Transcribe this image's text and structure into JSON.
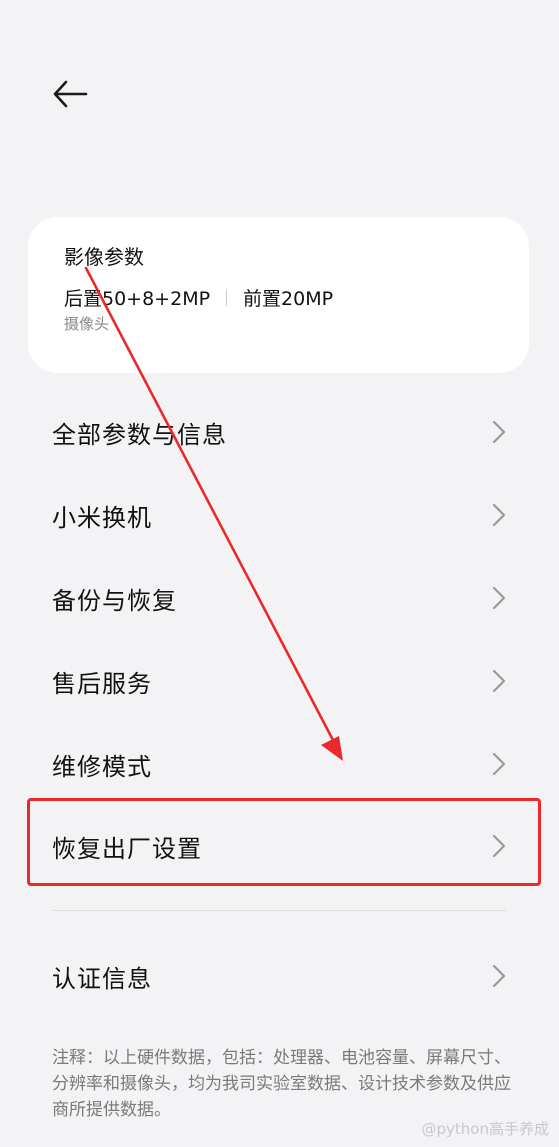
{
  "card": {
    "title": "影像参数",
    "rear": "后置50+8+2MP",
    "front": "前置20MP",
    "subtitle": "摄像头"
  },
  "menu": {
    "items": [
      {
        "label": "全部参数与信息"
      },
      {
        "label": "小米换机"
      },
      {
        "label": "备份与恢复"
      },
      {
        "label": "售后服务"
      },
      {
        "label": "维修模式"
      },
      {
        "label": "恢复出厂设置"
      },
      {
        "label": "认证信息"
      }
    ]
  },
  "note": "注释：以上硬件数据，包括：处理器、电池容量、屏幕尺寸、分辨率和摄像头，均为我司实验室数据、设计技术参数及供应商所提供数据。",
  "watermark": "@python高手养成",
  "icons": {
    "back": "back-arrow-icon",
    "chevron": "chevron-right-icon"
  },
  "colors": {
    "background": "#f3f3f5",
    "card": "#ffffff",
    "annotation_red": "#ea2a2a"
  }
}
